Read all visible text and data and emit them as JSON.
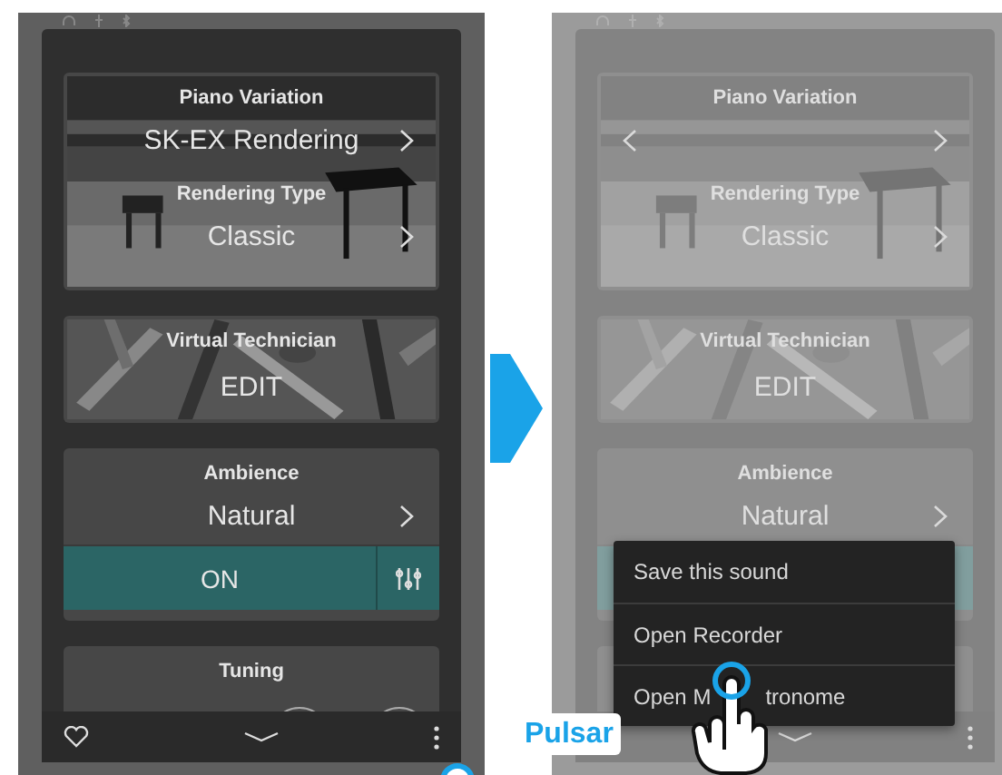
{
  "screens": [
    {
      "tap_marker": true,
      "cards": [
        {
          "kind": "piano",
          "sections": [
            {
              "title": "Piano Variation",
              "value": "SK-EX Rendering",
              "next": true
            },
            {
              "title": "Rendering Type",
              "value": "Classic",
              "next": true
            }
          ]
        },
        {
          "kind": "technician",
          "sections": [
            {
              "title": "Virtual Technician"
            }
          ],
          "action": "EDIT"
        },
        {
          "kind": "plain",
          "sections": [
            {
              "title": "Ambience",
              "value": "Natural",
              "next": true
            }
          ],
          "toggle": {
            "label": "ON",
            "on": true
          }
        },
        {
          "kind": "dials",
          "sections": [
            {
              "title": "Tuning"
            }
          ]
        }
      ]
    },
    {
      "dimmed": true,
      "cards": [
        {
          "kind": "piano",
          "sections": [
            {
              "title": "Piano Variation",
              "prev": true,
              "next": true
            },
            {
              "title": "Rendering Type",
              "value": "Classic",
              "next": true
            }
          ]
        },
        {
          "kind": "technician",
          "sections": [
            {
              "title": "Virtual Technician"
            }
          ],
          "action": "EDIT"
        },
        {
          "kind": "plain",
          "sections": [
            {
              "title": "Ambience",
              "value": "Natural",
              "next": true
            }
          ],
          "toggle": {
            "on": true
          }
        },
        {
          "kind": "dials"
        }
      ],
      "menu": {
        "items": [
          {
            "text": "Save this sound"
          },
          {
            "text": "Open Recorder"
          },
          {
            "text": "Open M",
            "text_after": "tronome"
          }
        ]
      },
      "hint": "Pulsar"
    }
  ]
}
